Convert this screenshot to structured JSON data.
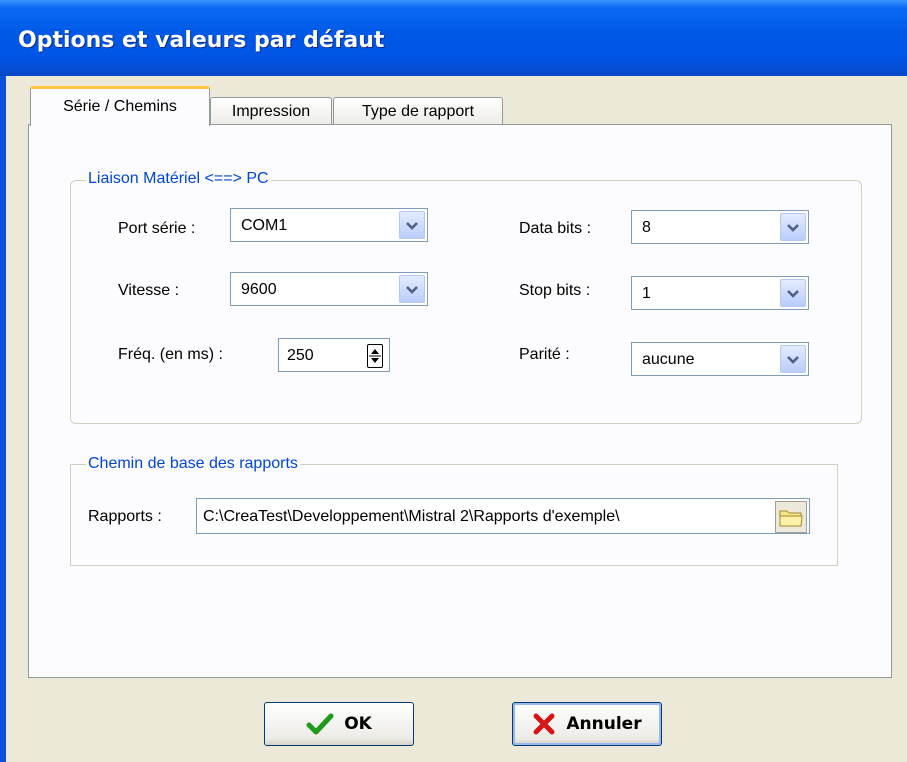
{
  "window": {
    "title": "Options et valeurs par défaut"
  },
  "tabs": [
    {
      "label": "Série / Chemins",
      "active": true
    },
    {
      "label": "Impression",
      "active": false
    },
    {
      "label": "Type de rapport",
      "active": false
    }
  ],
  "serial_group": {
    "legend": "Liaison Matériel <==> PC",
    "port": {
      "label": "Port série :",
      "value": "COM1"
    },
    "speed": {
      "label": "Vitesse :",
      "value": "9600"
    },
    "freq": {
      "label": "Fréq. (en ms) :",
      "value": "250"
    },
    "data_bits": {
      "label": "Data bits :",
      "value": "8"
    },
    "stop_bits": {
      "label": "Stop bits :",
      "value": "1"
    },
    "parity": {
      "label": "Parité :",
      "value": "aucune"
    }
  },
  "paths_group": {
    "legend": "Chemin de base des rapports",
    "reports": {
      "label": "Rapports :",
      "value": "C:\\CreaTest\\Developpement\\Mistral 2\\Rapports d'exemple\\"
    }
  },
  "buttons": {
    "ok": "OK",
    "cancel": "Annuler"
  },
  "colors": {
    "titlebar": "#0055e5",
    "group_legend": "#0046d5",
    "active_tab_highlight": "#ffc83c"
  },
  "icons": {
    "ok": "green-checkmark-icon",
    "cancel": "red-x-icon",
    "browse": "folder-icon",
    "dropdown": "chevron-down-icon"
  }
}
